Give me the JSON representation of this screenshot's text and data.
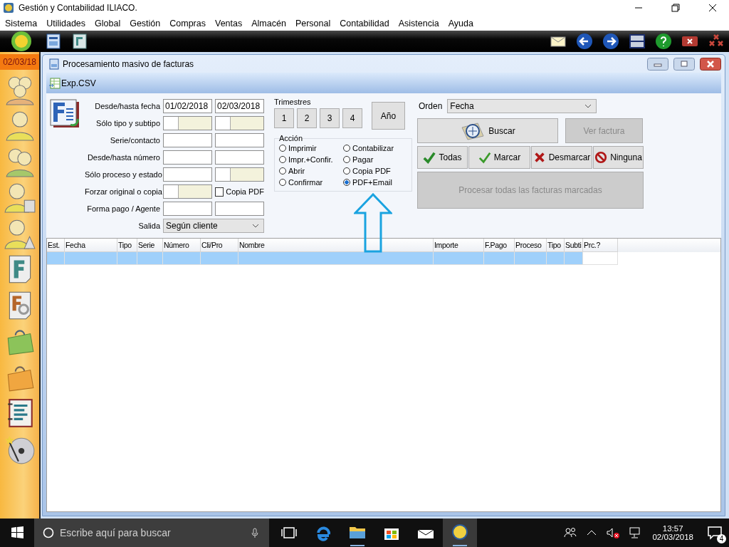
{
  "window": {
    "title": "Gestión y Contabilidad ILIACO."
  },
  "menu": [
    "Sistema",
    "Utilidades",
    "Global",
    "Gestión",
    "Compras",
    "Ventas",
    "Almacén",
    "Personal",
    "Contabilidad",
    "Asistencia",
    "Ayuda"
  ],
  "sidebar": {
    "date": "02/03/18"
  },
  "dialog": {
    "title": "Procesamiento masivo de facturas",
    "toolbar": [
      "Exp.CSV"
    ],
    "form": {
      "rows": [
        {
          "label": "Desde/hasta fecha",
          "fields": [
            {
              "kind": "text",
              "value": "01/02/2018"
            },
            {
              "kind": "text",
              "value": "02/03/2018"
            }
          ]
        },
        {
          "label": "Sólo tipo y subtipo",
          "fields": [
            {
              "kind": "split"
            },
            {
              "kind": "split"
            }
          ]
        },
        {
          "label": "Serie/contacto",
          "fields": [
            {
              "kind": "text"
            },
            {
              "kind": "text"
            }
          ]
        },
        {
          "label": "Desde/hasta número",
          "fields": [
            {
              "kind": "text"
            },
            {
              "kind": "text"
            }
          ]
        },
        {
          "label": "Sólo proceso y estado",
          "fields": [
            {
              "kind": "text"
            },
            {
              "kind": "split"
            }
          ]
        },
        {
          "label": "Forzar original o copia",
          "fields": [
            {
              "kind": "split"
            },
            {
              "kind": "checkbox",
              "label": "Copia PDF",
              "checked": false
            }
          ]
        },
        {
          "label": "Forma pago / Agente",
          "fields": [
            {
              "kind": "text"
            },
            {
              "kind": "text"
            }
          ]
        },
        {
          "label": "Salida",
          "fields": [
            {
              "kind": "select",
              "value": "Según cliente"
            }
          ]
        }
      ]
    },
    "trimestres": {
      "label": "Trimestres",
      "buttons": [
        "1",
        "2",
        "3",
        "4"
      ],
      "year_button": "Año"
    },
    "accion": {
      "title": "Acción",
      "options": [
        {
          "label": "Imprimir",
          "selected": false
        },
        {
          "label": "Impr.+Confir.",
          "selected": false
        },
        {
          "label": "Abrir",
          "selected": false
        },
        {
          "label": "Confirmar",
          "selected": false
        },
        {
          "label": "Contabilizar",
          "selected": false
        },
        {
          "label": "Pagar",
          "selected": false
        },
        {
          "label": "Copia PDF",
          "selected": false
        },
        {
          "label": "PDF+Email",
          "selected": true
        }
      ]
    },
    "orden": {
      "label": "Orden",
      "value": "Fecha"
    },
    "buttons": [
      {
        "kind": "search",
        "label": "Buscar",
        "disabled": false
      },
      {
        "kind": "plain",
        "label": "Ver factura",
        "disabled": true
      },
      {
        "kind": "check-double",
        "label": "Todas",
        "disabled": false
      },
      {
        "kind": "check",
        "label": "Marcar",
        "disabled": false
      },
      {
        "kind": "cross",
        "label": "Desmarcar",
        "disabled": false
      },
      {
        "kind": "none",
        "label": "Ninguna",
        "disabled": false
      },
      {
        "kind": "plain",
        "label": "Procesar todas las facturas marcadas",
        "disabled": true
      }
    ],
    "table": {
      "columns": [
        "Est.",
        "Fecha",
        "Tipo",
        "Serie",
        "Número",
        "Cli/Pro",
        "Nombre",
        "Importe",
        "F.Pago",
        "Proceso",
        "Tipo",
        "Subti",
        "Prc.?"
      ],
      "rows": [
        {
          "selected": true
        }
      ]
    }
  },
  "taskbar": {
    "search_placeholder": "Escribe aquí para buscar",
    "time": "13:57",
    "date": "02/03/2018",
    "notifications": "4"
  }
}
